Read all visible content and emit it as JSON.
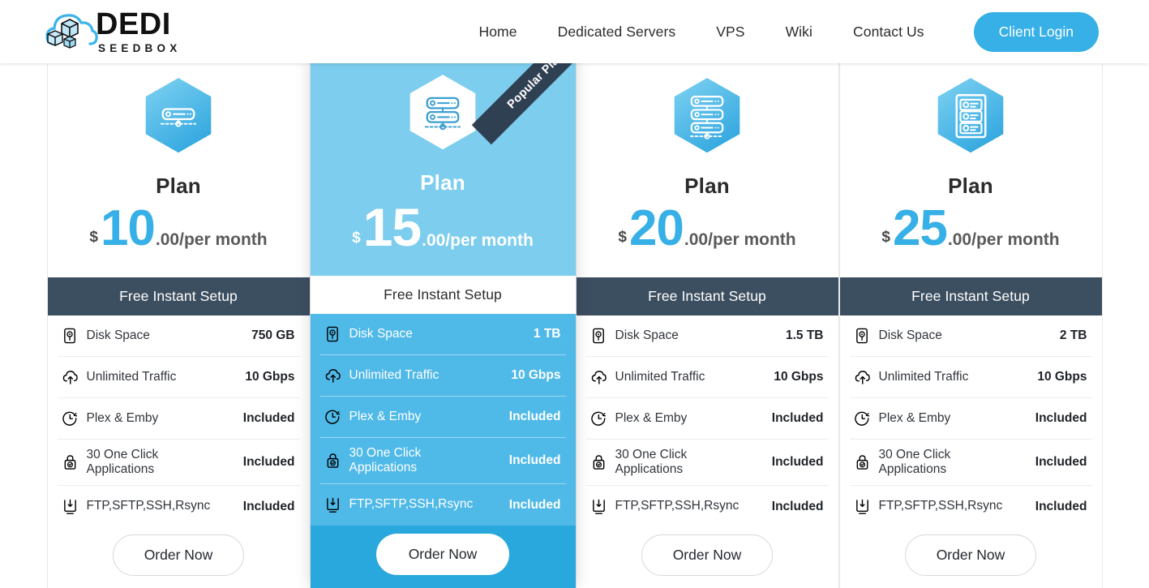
{
  "header": {
    "logo": {
      "main": "DEDI",
      "sub": "SEEDBOX",
      "icon": "cloud-cubes-logo"
    },
    "nav": [
      {
        "label": "Home",
        "name": "nav-home"
      },
      {
        "label": "Dedicated Servers",
        "name": "nav-dedicated-servers"
      },
      {
        "label": "VPS",
        "name": "nav-vps"
      },
      {
        "label": "Wiki",
        "name": "nav-wiki"
      },
      {
        "label": "Contact Us",
        "name": "nav-contact-us"
      }
    ],
    "client_login": "Client Login"
  },
  "colors": {
    "accent_blue": "#36b0e6",
    "featured_top": "#7ccdee",
    "featured_mid": "#4fb9e8",
    "featured_bottom": "#29a8dd",
    "setup_bar_dark": "#3c4f61",
    "ribbon_dark": "#2f4053"
  },
  "ribbon": {
    "text": "Popular Plan"
  },
  "labels": {
    "setup": "Free Instant Setup",
    "order": "Order Now",
    "currency": "$",
    "period": ".00/per month",
    "plan_name": "Plan"
  },
  "feature_names": [
    {
      "label": "Disk Space",
      "icon": "hard-drive-icon"
    },
    {
      "label": "Unlimited Traffic",
      "icon": "cloud-upload-icon"
    },
    {
      "label": "Plex & Emby",
      "icon": "clock-icon"
    },
    {
      "label": "30 One Click Applications",
      "icon": "lock-check-icon"
    },
    {
      "label": "FTP,SFTP,SSH,Rsync",
      "icon": "monitor-download-icon"
    }
  ],
  "plans": [
    {
      "name": "Plan",
      "currency": "$",
      "amount": "10",
      "period": ".00/per month",
      "icon": "server-single-icon",
      "featured": false,
      "setup": "Free Instant Setup",
      "order": "Order Now",
      "values": [
        "750 GB",
        "10 Gbps",
        "Included",
        "Included",
        "Included"
      ]
    },
    {
      "name": "Plan",
      "currency": "$",
      "amount": "15",
      "period": ".00/per month",
      "icon": "server-double-icon",
      "featured": true,
      "ribbon": "Popular Plan",
      "setup": "Free Instant Setup",
      "order": "Order Now",
      "values": [
        "1 TB",
        "10 Gbps",
        "Included",
        "Included",
        "Included"
      ]
    },
    {
      "name": "Plan",
      "currency": "$",
      "amount": "20",
      "period": ".00/per month",
      "icon": "server-triple-icon",
      "featured": false,
      "setup": "Free Instant Setup",
      "order": "Order Now",
      "values": [
        "1.5 TB",
        "10 Gbps",
        "Included",
        "Included",
        "Included"
      ]
    },
    {
      "name": "Plan",
      "currency": "$",
      "amount": "25",
      "period": ".00/per month",
      "icon": "server-cabinet-icon",
      "featured": false,
      "setup": "Free Instant Setup",
      "order": "Order Now",
      "values": [
        "2 TB",
        "10 Gbps",
        "Included",
        "Included",
        "Included"
      ]
    }
  ]
}
